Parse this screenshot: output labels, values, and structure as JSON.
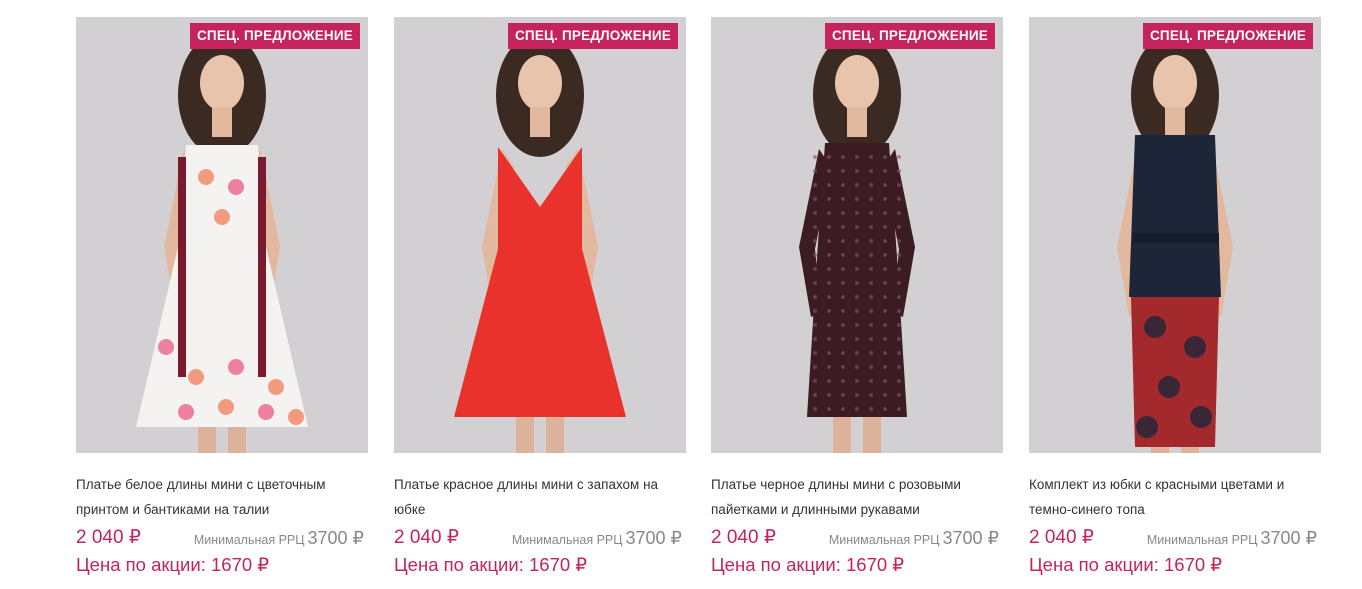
{
  "currency": "₽",
  "colors": {
    "accent": "#c4245b",
    "muted": "#888888",
    "text": "#333333"
  },
  "products": [
    {
      "badge": "СПЕЦ. ПРЕДЛОЖЕНИЕ",
      "name": "Платье белое длины мини с цветочным принтом и бантиками на талии",
      "price": "2 040 ₽",
      "rrc_label": "Минимальная РРЦ",
      "rrc_value": "3700 ₽",
      "promo": "Цена по акции: 1670 ₽",
      "dress_color": "#f4f3f2",
      "accent_color": "#7a1a2e"
    },
    {
      "badge": "СПЕЦ. ПРЕДЛОЖЕНИЕ",
      "name": "Платье красное длины мини с запахом на юбке",
      "price": "2 040 ₽",
      "rrc_label": "Минимальная РРЦ",
      "rrc_value": "3700 ₽",
      "promo": "Цена по акции: 1670 ₽",
      "dress_color": "#e8322b",
      "accent_color": "#c41f1f"
    },
    {
      "badge": "СПЕЦ. ПРЕДЛОЖЕНИЕ",
      "name": "Платье черное длины мини с розовыми пайетками и длинными рукавами",
      "price": "2 040 ₽",
      "rrc_label": "Минимальная РРЦ",
      "rrc_value": "3700 ₽",
      "promo": "Цена по акции: 1670 ₽",
      "dress_color": "#3a1c22",
      "accent_color": "#5e2c35"
    },
    {
      "badge": "СПЕЦ. ПРЕДЛОЖЕНИЕ",
      "name": "Комплект из юбки с красными цветами и темно-синего топа",
      "price": "2 040 ₽",
      "rrc_label": "Минимальная РРЦ",
      "rrc_value": "3700 ₽",
      "promo": "Цена по акции: 1670 ₽",
      "dress_color": "#1d2538",
      "accent_color": "#a3292d"
    }
  ]
}
